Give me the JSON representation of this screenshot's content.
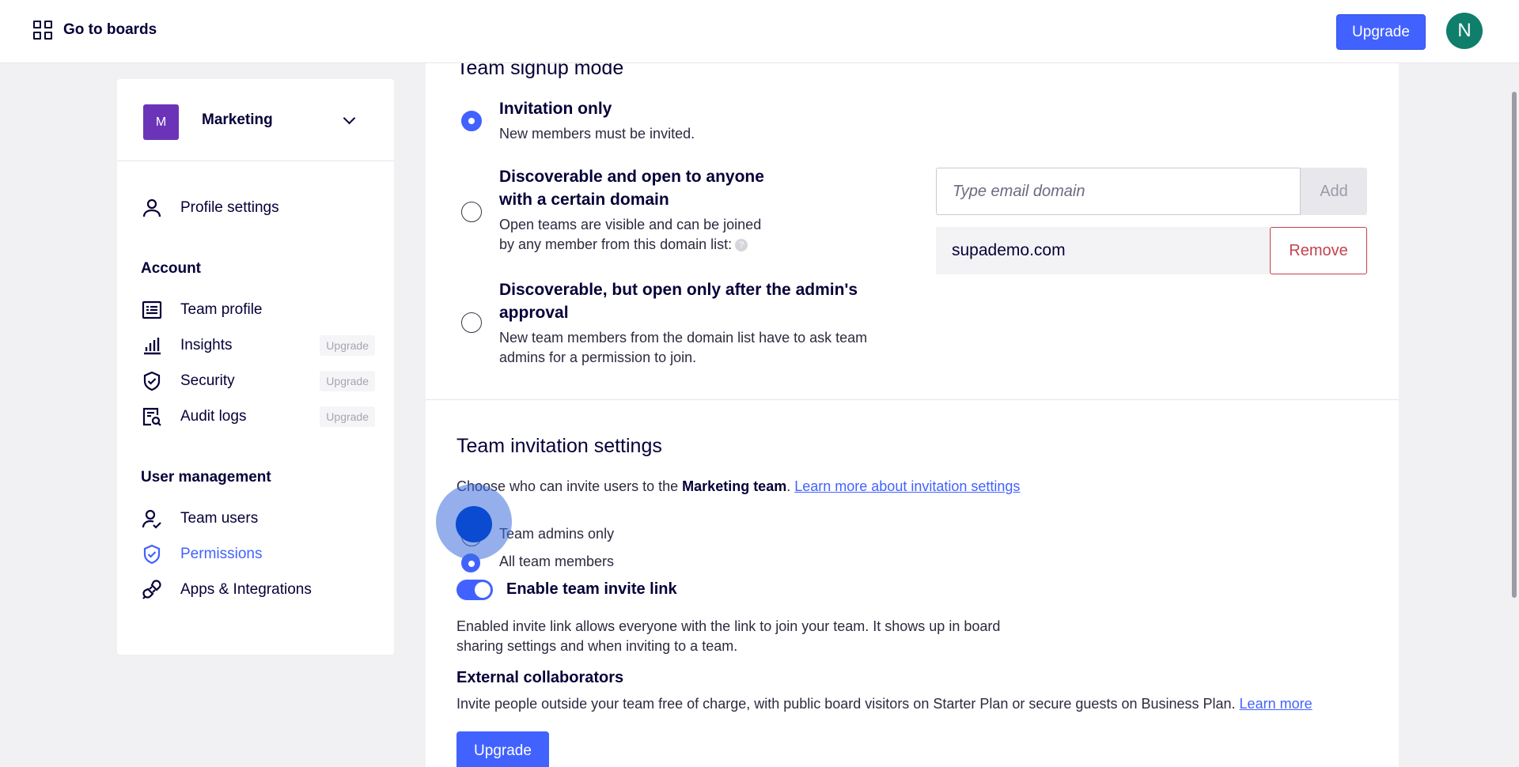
{
  "topbar": {
    "goto_label": "Go to boards",
    "upgrade_label": "Upgrade",
    "avatar_initial": "N"
  },
  "sidebar": {
    "team": {
      "initial": "M",
      "name": "Marketing"
    },
    "profile_settings": "Profile settings",
    "account_heading": "Account",
    "account_items": [
      {
        "label": "Team profile",
        "badge": ""
      },
      {
        "label": "Insights",
        "badge": "Upgrade"
      },
      {
        "label": "Security",
        "badge": "Upgrade"
      },
      {
        "label": "Audit logs",
        "badge": "Upgrade"
      }
    ],
    "user_mgmt_heading": "User management",
    "user_items": [
      {
        "label": "Team users",
        "active": false
      },
      {
        "label": "Permissions",
        "active": true
      },
      {
        "label": "Apps & Integrations",
        "active": false
      }
    ]
  },
  "signup": {
    "title": "Team signup mode",
    "options": [
      {
        "title": "Invitation only",
        "desc": "New members must be invited.",
        "selected": true
      },
      {
        "title_line1": "Discoverable and open to anyone",
        "title_line2": "with a certain domain",
        "desc_line1": "Open teams are visible and can be joined",
        "desc_line2": "by any member from this domain list:",
        "selected": false
      },
      {
        "title_line1": "Discoverable, but open only after the admin's",
        "title_line2": "approval",
        "desc_line1": "New team members from the domain list have to ask team",
        "desc_line2": "admins for a permission to join.",
        "selected": false
      }
    ],
    "domain_placeholder": "Type email domain",
    "add_label": "Add",
    "domains": [
      "supademo.com"
    ],
    "remove_label": "Remove"
  },
  "invitation": {
    "title": "Team invitation settings",
    "intro_prefix": "Choose who can invite users to the ",
    "intro_team": "Marketing team",
    "intro_suffix": ". ",
    "intro_link": "Learn more about invitation settings",
    "option_admins": "Team admins only",
    "option_all": "All team members",
    "selected": "All team members",
    "invite_link_label": "Enable team invite link",
    "invite_link_enabled": true,
    "invite_link_desc_line1": "Enabled invite link allows everyone with the link to join your team. It shows up in board",
    "invite_link_desc_line2": "sharing settings and when inviting to a team.",
    "external_title": "External collaborators",
    "external_desc": "Invite people outside your team free of charge, with public board visitors on Starter Plan or secure guests on Business Plan. ",
    "external_link": "Learn more",
    "upgrade_label": "Upgrade"
  },
  "colors": {
    "accent": "#4262ff",
    "danger": "#c4424f",
    "team_logo": "#6b34b8",
    "avatar": "#0f7e6a"
  },
  "icons": [
    "grid-icon",
    "chevron-down-icon",
    "user-icon",
    "profile-card-icon",
    "insights-icon",
    "shield-icon",
    "audit-icon",
    "user-check-icon",
    "shield-check-icon",
    "plug-icon",
    "help-icon"
  ]
}
